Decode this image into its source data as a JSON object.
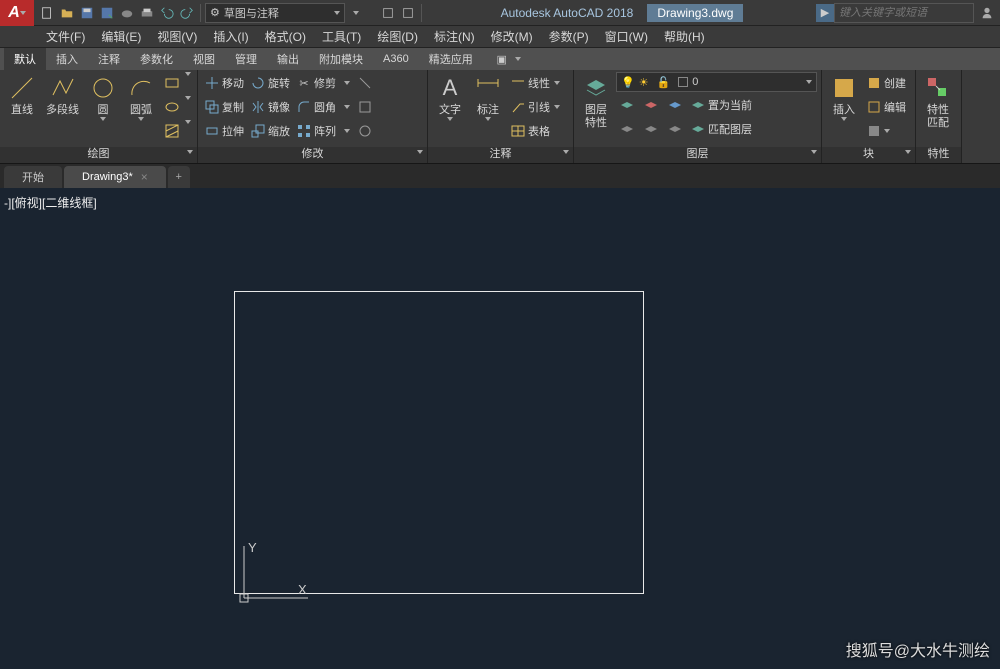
{
  "title": {
    "app": "Autodesk AutoCAD 2018",
    "doc": "Drawing3.dwg",
    "workspace": "草图与注释"
  },
  "search": {
    "placeholder": "键入关键字或短语"
  },
  "menu": {
    "file": "文件(F)",
    "edit": "编辑(E)",
    "view": "视图(V)",
    "insert": "插入(I)",
    "format": "格式(O)",
    "tools": "工具(T)",
    "draw": "绘图(D)",
    "dim": "标注(N)",
    "modify": "修改(M)",
    "param": "参数(P)",
    "window": "窗口(W)",
    "help": "帮助(H)"
  },
  "tabs": {
    "default": "默认",
    "insert": "插入",
    "annotate": "注释",
    "param": "参数化",
    "view": "视图",
    "manage": "管理",
    "output": "输出",
    "addins": "附加模块",
    "a360": "A360",
    "featured": "精选应用"
  },
  "ribbon": {
    "draw": {
      "title": "绘图",
      "line": "直线",
      "polyline": "多段线",
      "circle": "圆",
      "arc": "圆弧"
    },
    "modify": {
      "title": "修改",
      "move": "移动",
      "copy": "复制",
      "stretch": "拉伸",
      "rotate": "旋转",
      "mirror": "镜像",
      "scale": "缩放",
      "trim": "修剪",
      "fillet": "圆角",
      "array": "阵列"
    },
    "annot": {
      "title": "注释",
      "text": "文字",
      "dim": "标注",
      "leader": "引线",
      "table": "表格",
      "linear": "线性"
    },
    "layer": {
      "title": "图层",
      "props": "图层\n特性",
      "current": "0",
      "setcur": "置为当前",
      "match": "匹配图层"
    },
    "block": {
      "title": "块",
      "insert": "插入",
      "create": "创建",
      "edit": "编辑"
    },
    "props": {
      "title": "特性",
      "match": "特性\n匹配"
    }
  },
  "filetabs": {
    "start": "开始",
    "drawing": "Drawing3*"
  },
  "canvas": {
    "view": "-][俯视][二维线框]",
    "x": "X",
    "y": "Y"
  },
  "watermark": "搜狐号@大水牛测绘"
}
